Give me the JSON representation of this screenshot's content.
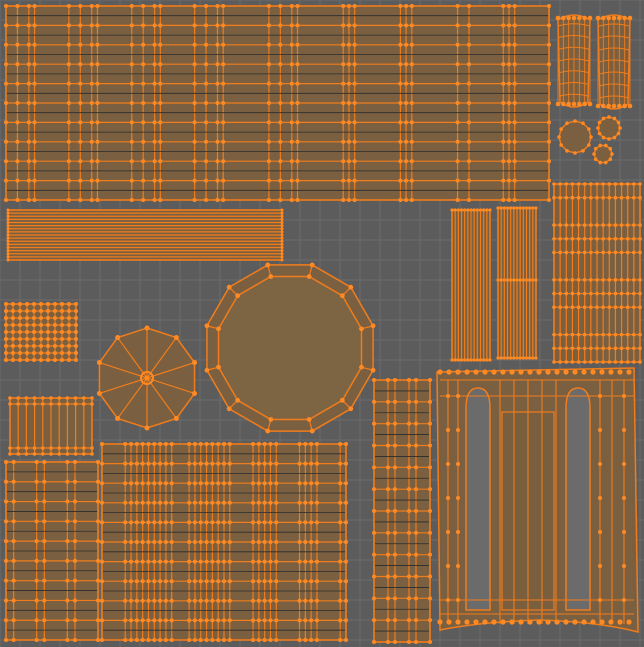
{
  "editor": {
    "view": "uv-editor",
    "grid_visible": true
  },
  "colors": {
    "background": "#5c5c5c",
    "grid_line": "#6b6b6b",
    "face_fill": "#7a6040",
    "edge": "#f07c1c",
    "vertex": "#ff8a24",
    "dark_edge": "#2b2b2b"
  },
  "uv_islands": [
    {
      "name": "large-plank-island"
    },
    {
      "name": "horizontal-strip-island"
    },
    {
      "name": "small-grid-island"
    },
    {
      "name": "small-dome-cap-island"
    },
    {
      "name": "dodecagon-disc-island"
    },
    {
      "name": "small-plank-island"
    },
    {
      "name": "left-plank-grid-island"
    },
    {
      "name": "middle-plank-grid-island"
    },
    {
      "name": "narrow-column-island"
    },
    {
      "name": "arch-panel-island"
    },
    {
      "name": "vertical-slat-island-a"
    },
    {
      "name": "vertical-slat-island-b"
    },
    {
      "name": "right-side-grid-island"
    },
    {
      "name": "barrel-island-a"
    },
    {
      "name": "barrel-island-b"
    },
    {
      "name": "small-disc-island-a"
    },
    {
      "name": "small-disc-island-b"
    },
    {
      "name": "small-disc-island-c"
    }
  ]
}
